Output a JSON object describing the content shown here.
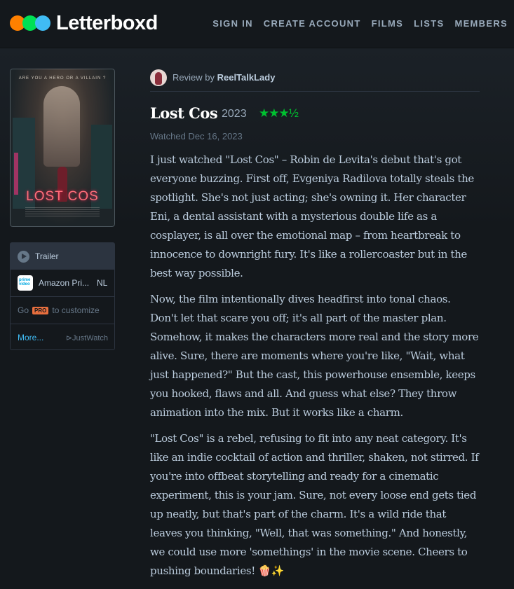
{
  "brand": {
    "name": "Letterboxd",
    "colors": {
      "orange": "#ff8000",
      "green": "#00e054",
      "blue": "#40bcf4",
      "background": "#14181c"
    }
  },
  "nav": [
    "SIGN IN",
    "CREATE ACCOUNT",
    "FILMS",
    "LISTS",
    "MEMBERS"
  ],
  "poster": {
    "tagline": "ARE YOU A HERO OR A VILLAIN ?",
    "title_art": "LOST COS"
  },
  "watch": {
    "trailer_label": "Trailer",
    "service_name": "Amazon Pri...",
    "service_region": "NL",
    "service_icon_text": "prime video",
    "go_text": "Go",
    "pro_badge": "PRO",
    "customize_text": "to customize",
    "more_label": "More...",
    "justwatch_label": "JustWatch"
  },
  "review": {
    "byline_prefix": "Review by",
    "author": "ReelTalkLady",
    "film_title": "Lost Cos",
    "year": "2023",
    "rating_stars": "★★★½",
    "rating_value": 3.5,
    "watched_date": "Watched Dec 16, 2023",
    "paragraphs": [
      "I just watched \"Lost Cos\" – Robin de Levita's debut that's got everyone buzzing. First off, Evgeniya Radilova totally steals the spotlight. She's not just acting; she's owning it. Her character Eni, a dental assistant with a mysterious double life as a cosplayer, is all over the emotional map – from heartbreak to innocence to downright fury. It's like a rollercoaster but in the best way possible.",
      "Now, the film intentionally dives headfirst into tonal chaos. Don't let that scare you off; it's all part of the master plan. Somehow, it makes the characters more real and the story more alive. Sure, there are moments where you're like, \"Wait, what just happened?\" But the cast, this powerhouse ensemble, keeps you hooked, flaws and all. And guess what else? They throw animation into the mix. But it works like a charm.",
      "\"Lost Cos\" is a rebel, refusing to fit into any neat category. It's like an indie cocktail of action and thriller, shaken, not stirred. If you're into offbeat storytelling and ready for a cinematic experiment, this is your jam. Sure, not every loose end gets tied up neatly, but that's part of the charm. It's a wild ride that leaves you thinking, \"Well, that was something.\" And honestly, we could use more 'somethings' in the movie scene. Cheers to pushing boundaries! 🍿✨"
    ]
  }
}
